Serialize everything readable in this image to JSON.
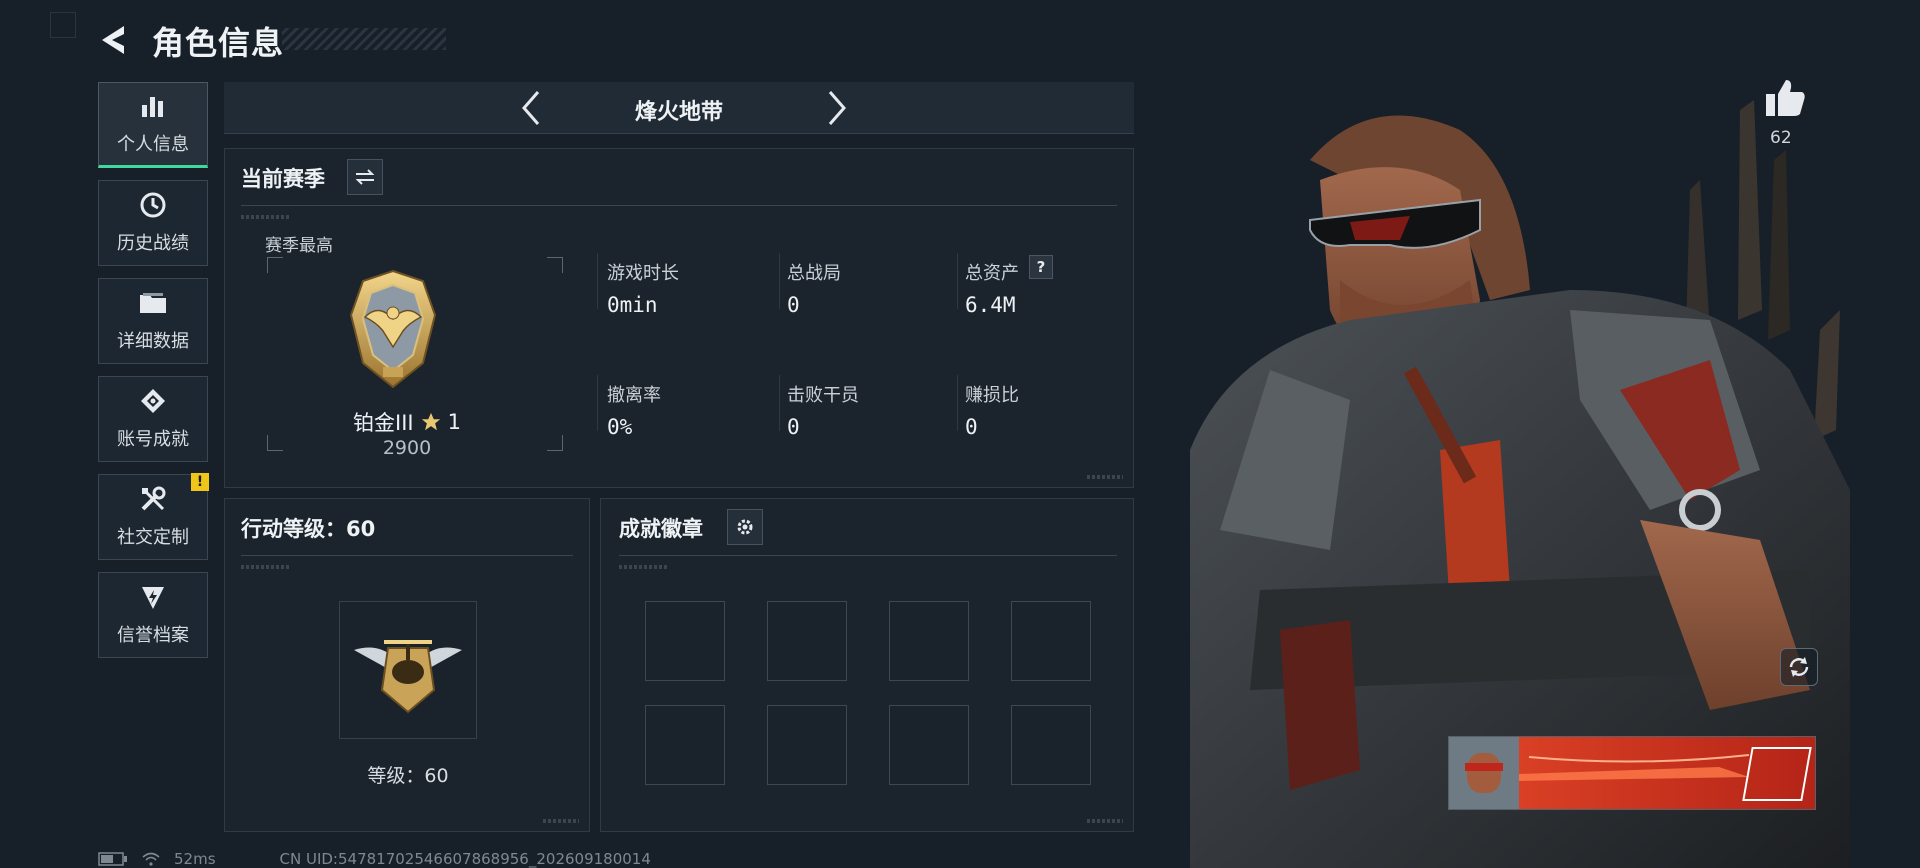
{
  "header": {
    "title": "角色信息"
  },
  "sidebar": {
    "items": [
      {
        "label": "个人信息",
        "icon": "bar-chart-icon",
        "active": true
      },
      {
        "label": "历史战绩",
        "icon": "clock-icon"
      },
      {
        "label": "详细数据",
        "icon": "folder-icon"
      },
      {
        "label": "账号成就",
        "icon": "achievement-icon"
      },
      {
        "label": "社交定制",
        "icon": "tools-icon",
        "badge": "!"
      },
      {
        "label": "信誉档案",
        "icon": "shield-bolt-icon"
      }
    ]
  },
  "mode_bar": {
    "title": "烽火地带"
  },
  "season": {
    "title": "当前赛季",
    "best_label": "赛季最高",
    "rank_name": "铂金III",
    "rank_stars": "1",
    "rank_score": "2900",
    "stats": [
      {
        "label": "游戏时长",
        "value": "0min"
      },
      {
        "label": "总战局",
        "value": "0"
      },
      {
        "label": "总资产",
        "value": "6.4M",
        "help": "?"
      },
      {
        "label": "撤离率",
        "value": "0%"
      },
      {
        "label": "击败干员",
        "value": "0"
      },
      {
        "label": "赚损比",
        "value": "0"
      }
    ]
  },
  "action_level": {
    "title": "行动等级：60",
    "level_text": "等级：60"
  },
  "achievements": {
    "title": "成就徽章"
  },
  "character": {
    "likes": "62"
  },
  "status_bar": {
    "ping": "52ms",
    "uid": "CN UID:5478170254660786895​6_202609180014"
  },
  "colors": {
    "accent": "#3fd9a0",
    "badge": "#f0c419",
    "background": "#172029"
  }
}
